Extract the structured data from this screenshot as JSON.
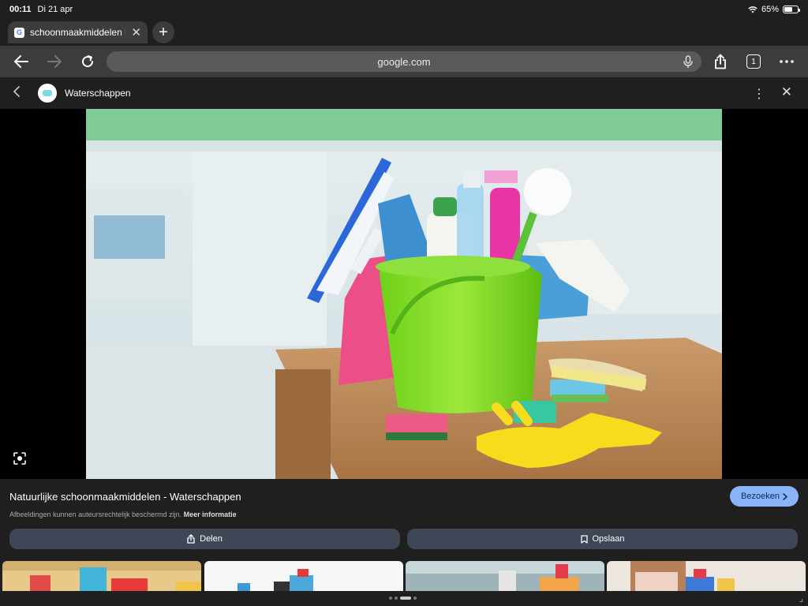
{
  "status": {
    "time": "00:11",
    "date": "Di 21 apr",
    "battery": "65%",
    "battery_level": 0.65
  },
  "tabs": [
    {
      "title": "schoonmaakmiddelen k"
    }
  ],
  "toolbar": {
    "url": "google.com"
  },
  "viewer": {
    "source_name": "Waterschappen"
  },
  "result": {
    "title": "Natuurlijke schoonmaakmiddelen - Waterschappen",
    "notice": "Afbeeldingen kunnen auteursrechtelijk beschermd zijn.",
    "notice_link": "Meer informatie",
    "visit_label": "Bezoeken",
    "share_label": "Delen",
    "save_label": "Opslaan"
  },
  "icons": {
    "back": "arrow-left-icon",
    "forward": "arrow-right-icon",
    "reload": "reload-icon",
    "mic": "mic-icon",
    "share": "share-icon",
    "tabs": "tab-count-icon",
    "more": "more-icon",
    "close": "close-icon",
    "lens": "lens-icon",
    "bookmark": "bookmark-icon"
  },
  "colors": {
    "accent": "#8ab4f8",
    "toolbar": "#3c3c3c",
    "action_button": "#3f4656"
  }
}
